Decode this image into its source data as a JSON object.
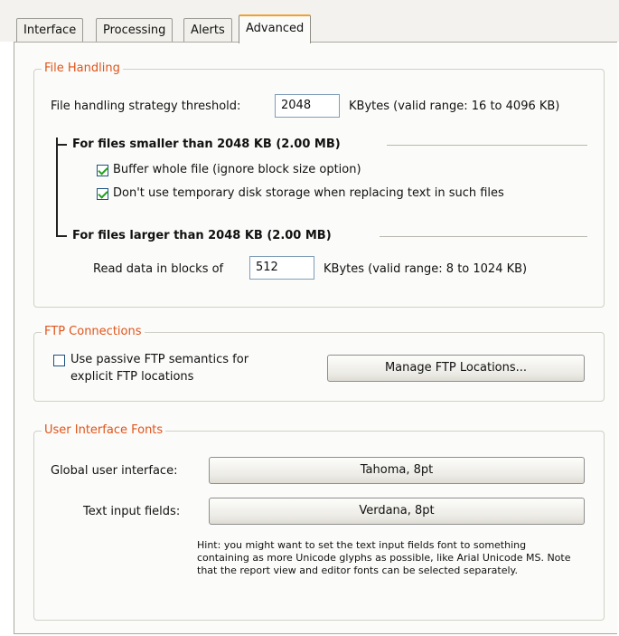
{
  "tabs": [
    {
      "label": "Interface",
      "active": false
    },
    {
      "label": "Processing",
      "active": false
    },
    {
      "label": "Alerts",
      "active": false
    },
    {
      "label": "Advanced",
      "active": true
    }
  ],
  "file_handling": {
    "title": "File Handling",
    "threshold_label": "File handling strategy threshold:",
    "threshold_value": "2048",
    "threshold_hint": "KBytes (valid range: 16 to 4096 KB)",
    "smaller": {
      "heading": "For files smaller than 2048 KB (2.00 MB)",
      "options": [
        {
          "label": "Buffer whole file (ignore block size option)",
          "checked": true
        },
        {
          "label": "Don't use temporary disk storage when replacing text in such files",
          "checked": true
        }
      ]
    },
    "larger": {
      "heading": "For files larger than 2048 KB (2.00 MB)",
      "block_label": "Read data in blocks of",
      "block_value": "512",
      "block_hint": "KBytes (valid range: 8 to 1024 KB)"
    }
  },
  "ftp": {
    "title": "FTP Connections",
    "passive_line1": "Use passive FTP semantics for",
    "passive_line2": "explicit FTP locations",
    "passive_checked": false,
    "manage_button": "Manage FTP Locations..."
  },
  "fonts": {
    "title": "User Interface Fonts",
    "global_label": "Global user interface:",
    "global_value": "Tahoma, 8pt",
    "input_label": "Text input fields:",
    "input_value": "Verdana, 8pt",
    "hint": "Hint: you might want to set the text input fields font to something containing as more Unicode glyphs as possible, like Arial Unicode MS. Note that the report view and editor fonts can be selected separately."
  },
  "colors": {
    "accent_orange": "#e0541a",
    "check_green": "#21a121",
    "active_tab_top": "#f0a030"
  }
}
